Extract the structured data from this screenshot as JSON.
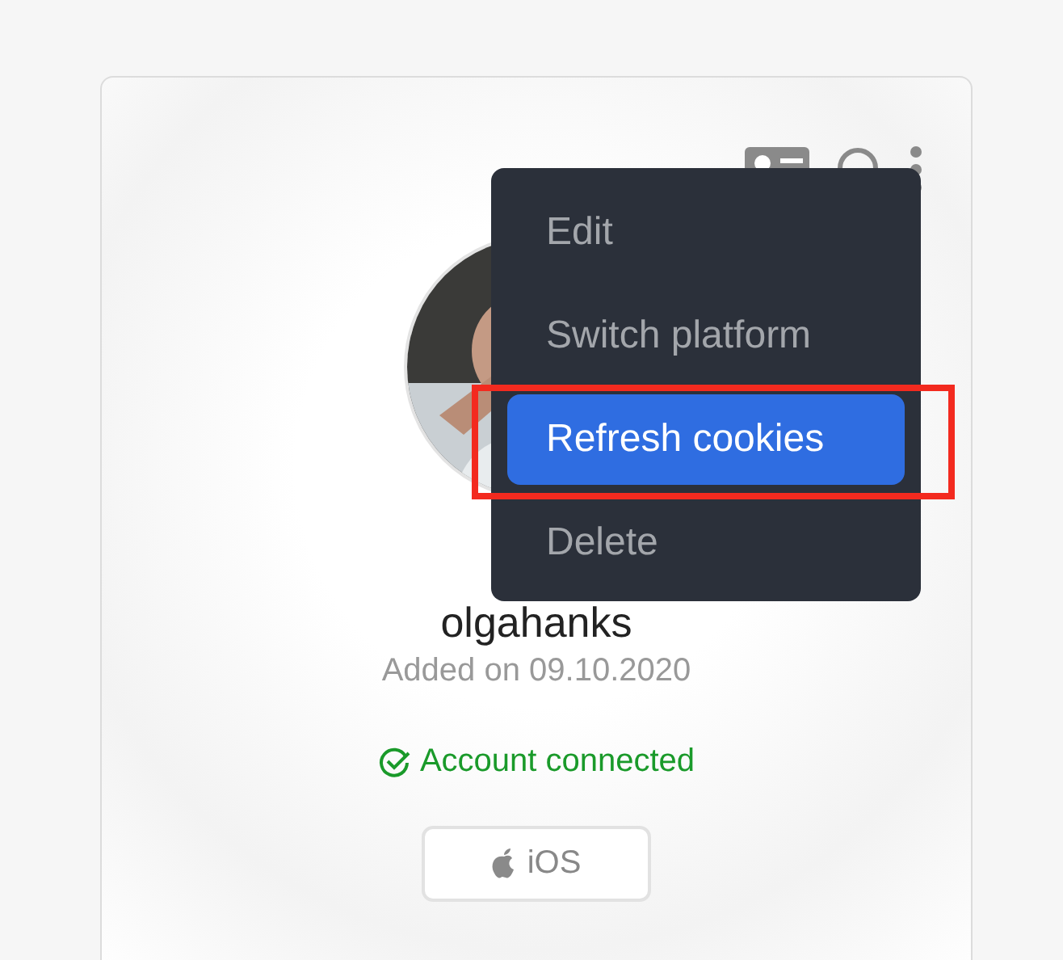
{
  "profile": {
    "username": "olgahanks",
    "added": "Added on 09.10.2020",
    "status": {
      "text": "Account connected",
      "connected": true
    },
    "platform": "iOS"
  },
  "menu": {
    "open": true,
    "items": [
      {
        "label": "Edit",
        "selected": false,
        "highlighted": false
      },
      {
        "label": "Switch platform",
        "selected": false,
        "highlighted": false
      },
      {
        "label": "Refresh cookies",
        "selected": true,
        "highlighted": true
      },
      {
        "label": "Delete",
        "selected": false,
        "highlighted": false
      }
    ]
  }
}
